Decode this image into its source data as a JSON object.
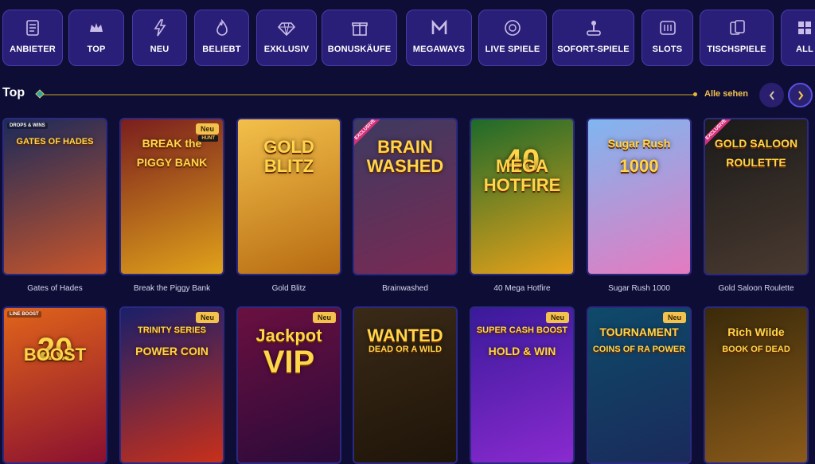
{
  "categories": [
    {
      "label": "ANBIETER",
      "icon": "scroll-icon"
    },
    {
      "label": "TOP",
      "icon": "crown-icon"
    },
    {
      "label": "NEU",
      "icon": "lightning-icon"
    },
    {
      "label": "BELIEBT",
      "icon": "flame-icon"
    },
    {
      "label": "EXKLUSIV",
      "icon": "diamond-icon"
    },
    {
      "label": "BONUSKÄUFE",
      "icon": "gift-icon"
    },
    {
      "label": "MEGAWAYS",
      "icon": "m-icon"
    },
    {
      "label": "LIVE SPIELE",
      "icon": "chip-icon"
    },
    {
      "label": "SOFORT-SPIELE",
      "icon": "joystick-icon"
    },
    {
      "label": "SLOTS",
      "icon": "slot-machine-icon"
    },
    {
      "label": "TISCHSPIELE",
      "icon": "cards-icon"
    },
    {
      "label": "ALL",
      "icon": "grid-icon"
    }
  ],
  "section": {
    "title": "Top",
    "see_all": "Alle sehen",
    "prev": "‹",
    "next": "›"
  },
  "games_row1": [
    {
      "name": "Gates of Hades",
      "art_line1": "GATES OF HADES",
      "art_line2": "",
      "badge": "",
      "excl": false,
      "corner_label": "DROPS & WINS",
      "colors": [
        "#1b2a5a",
        "#c8552a"
      ]
    },
    {
      "name": "Break the Piggy Bank",
      "art_line1": "BREAK the",
      "art_line2": "PIGGY BANK",
      "badge": "Neu",
      "excl": false,
      "badge2": "HUNT",
      "colors": [
        "#7a1e1e",
        "#e0a21a"
      ]
    },
    {
      "name": "Gold Blitz",
      "art_line1": "GOLD",
      "art_line2": "BLITZ",
      "badge": "",
      "excl": false,
      "colors": [
        "#f3c04a",
        "#b66a12"
      ]
    },
    {
      "name": "Brainwashed",
      "art_line1": "BRAIN",
      "art_line2": "WASHED",
      "badge": "",
      "excl": true,
      "excl_label": "EXCLUSIVE",
      "colors": [
        "#3d3a60",
        "#7a2a54"
      ]
    },
    {
      "name": "40 Mega Hotfire",
      "art_line1": "40",
      "art_line2": "MEGA",
      "art_line3": "HOTFIRE",
      "badge": "",
      "excl": false,
      "colors": [
        "#1d6a2a",
        "#e8a21a"
      ]
    },
    {
      "name": "Sugar Rush 1000",
      "art_line1": "Sugar Rush",
      "art_line2": "1000",
      "badge": "",
      "excl": false,
      "colors": [
        "#7fb6f0",
        "#e57ac0"
      ]
    },
    {
      "name": "Gold Saloon Roulette",
      "art_line1": "GOLD SALOON",
      "art_line2": "ROULETTE",
      "badge": "",
      "excl": true,
      "excl_label": "EXCLUSIVE",
      "colors": [
        "#1a1a1a",
        "#4a3a30"
      ]
    }
  ],
  "games_row2": [
    {
      "art_line1": "20",
      "art_line2": "BOOST",
      "badge": "",
      "corner_label": "LINE BOOST",
      "colors": [
        "#e0641a",
        "#8a1030"
      ]
    },
    {
      "art_line1": "TRINITY SERIES",
      "art_line2": "POWER COIN",
      "badge": "Neu",
      "colors": [
        "#1a1f6a",
        "#c8301a"
      ]
    },
    {
      "art_line1": "Jackpot",
      "art_line2": "VIP",
      "badge": "Neu",
      "colors": [
        "#6a1040",
        "#2a0a3a"
      ]
    },
    {
      "art_line1": "WANTED",
      "art_line2": "DEAD OR A WILD",
      "badge": "",
      "colors": [
        "#3a2a18",
        "#1e1408"
      ]
    },
    {
      "art_line1": "SUPER CASH BOOST",
      "art_line2": "HOLD & WIN",
      "badge": "Neu",
      "colors": [
        "#3a1a9a",
        "#8a2ad0"
      ]
    },
    {
      "art_line1": "TOURNAMENT",
      "art_line2": "COINS OF RA POWER",
      "badge": "Neu",
      "colors": [
        "#0e4a6a",
        "#1a2a5a"
      ]
    },
    {
      "art_line1": "Rich Wilde",
      "art_line2": "BOOK OF DEAD",
      "badge": "",
      "colors": [
        "#3a2a0a",
        "#8a5a1a"
      ]
    }
  ]
}
